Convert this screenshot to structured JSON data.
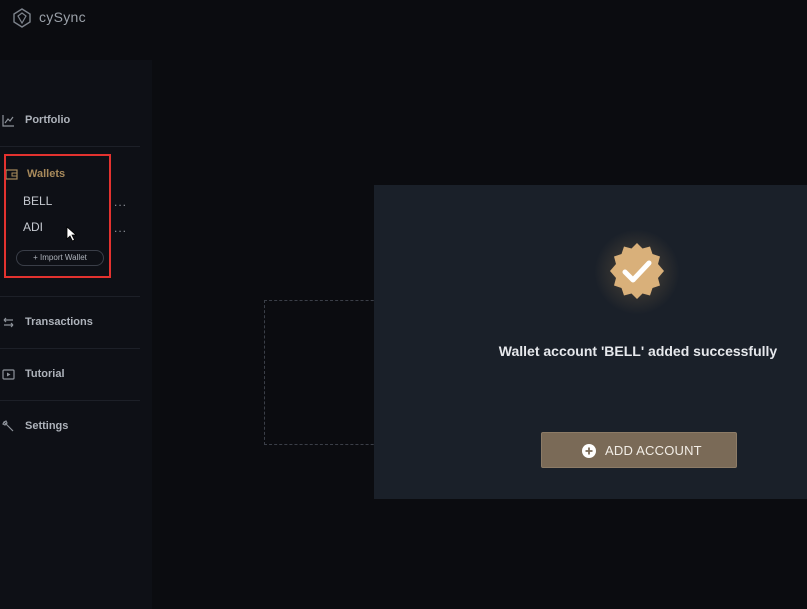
{
  "app": {
    "title": "cySync"
  },
  "sidebar": {
    "portfolio_label": "Portfolio",
    "wallets_label": "Wallets",
    "wallets": [
      {
        "name": "BELL",
        "menu": "..."
      },
      {
        "name": "ADI",
        "menu": "..."
      }
    ],
    "import_wallet_label": "+ Import Wallet",
    "transactions_label": "Transactions",
    "tutorial_label": "Tutorial",
    "settings_label": "Settings"
  },
  "modal": {
    "message": "Wallet account 'BELL' added successfully",
    "add_account_label": "ADD ACCOUNT"
  },
  "colors": {
    "accent_gold": "#d9b07a",
    "highlight_red": "#e3322f",
    "button_bg": "#7a6a57",
    "modal_bg": "#1a2029"
  }
}
